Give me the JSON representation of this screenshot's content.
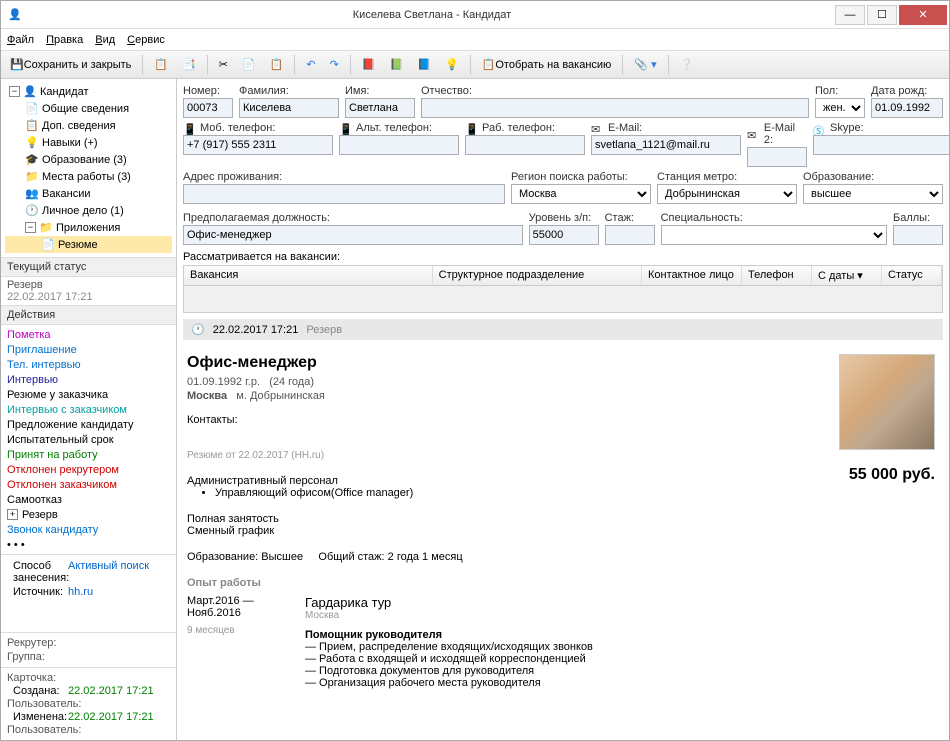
{
  "window": {
    "title": "Киселева Светлана - Кандидат"
  },
  "menu": {
    "file": "Файл",
    "edit": "Правка",
    "view": "Вид",
    "service": "Сервис"
  },
  "toolbar": {
    "save_close": "Сохранить и закрыть",
    "select_vacancy": "Отобрать на вакансию"
  },
  "tree": {
    "root": "Кандидат",
    "general": "Общие сведения",
    "additional": "Доп. сведения",
    "skills": "Навыки (+)",
    "education": "Образование (3)",
    "workplaces": "Места работы (3)",
    "vacancies": "Вакансии",
    "personal": "Личное дело  (1)",
    "attachments": "Приложения",
    "resume": "Резюме"
  },
  "status": {
    "title": "Текущий статус",
    "value": "Резерв",
    "date": "22.02.2017 17:21"
  },
  "actions": {
    "title": "Действия",
    "items": [
      {
        "label": "Пометка",
        "cls": "magenta"
      },
      {
        "label": "Приглашение",
        "cls": "blue"
      },
      {
        "label": "Тел. интервью",
        "cls": "blue"
      },
      {
        "label": "Интервью",
        "cls": "navy"
      },
      {
        "label": "Резюме у заказчика",
        "cls": ""
      },
      {
        "label": "Интервью с заказчиком",
        "cls": "cyan"
      },
      {
        "label": "Предложение кандидату",
        "cls": ""
      },
      {
        "label": "Испытательный срок",
        "cls": ""
      },
      {
        "label": "Принят на работу",
        "cls": "green"
      },
      {
        "label": "Отклонен рекрутером",
        "cls": "red"
      },
      {
        "label": "Отклонен заказчиком",
        "cls": "red"
      },
      {
        "label": "Самоотказ",
        "cls": ""
      },
      {
        "label": "Резерв",
        "cls": ""
      },
      {
        "label": "Звонок кандидату",
        "cls": "blue"
      },
      {
        "label": "• • •",
        "cls": ""
      }
    ]
  },
  "meta": {
    "method_label": "Способ занесения:",
    "method_value": "Активный поиск",
    "source_label": "Источник:",
    "source_value": "hh.ru",
    "recruiter_label": "Рекрутер:",
    "group_label": "Группа:",
    "card_label": "Карточка:",
    "created_label": "Создана:",
    "created_value": "22.02.2017 17:21",
    "user1_label": "Пользователь:",
    "changed_label": "Изменена:",
    "changed_value": "22.02.2017 17:21",
    "user2_label": "Пользователь:"
  },
  "form": {
    "number_label": "Номер:",
    "number": "00073",
    "lastname_label": "Фамилия:",
    "lastname": "Киселева",
    "firstname_label": "Имя:",
    "firstname": "Светлана",
    "middlename_label": "Отчество:",
    "middlename": "",
    "sex_label": "Пол:",
    "sex": "жен.",
    "dob_label": "Дата рожд:",
    "dob": "01.09.1992",
    "mobile_label": "Моб. телефон:",
    "mobile": "+7 (917) 555 2311",
    "alt_label": "Альт. телефон:",
    "alt": "",
    "work_label": "Раб. телефон:",
    "work": "",
    "email_label": "E-Mail:",
    "email": "svetlana_1121@mail.ru",
    "email2_label": "E-Mail 2:",
    "email2": "",
    "skype_label": "Skype:",
    "skype": "",
    "address_label": "Адрес проживания:",
    "address": "",
    "region_label": "Регион поиска работы:",
    "region": "Москва",
    "metro_label": "Станция метро:",
    "metro": "Добрынинская",
    "edu_label": "Образование:",
    "edu": "высшее",
    "position_label": "Предполагаемая должность:",
    "position": "Офис-менеджер",
    "salary_label": "Уровень з/п:",
    "salary": "55000",
    "experience_label": "Стаж:",
    "experience": "",
    "speciality_label": "Специальность:",
    "speciality": "",
    "points_label": "Баллы:",
    "points": "",
    "vacancies_label": "Рассматривается на вакансии:"
  },
  "grid": {
    "col1": "Вакансия",
    "col2": "Структурное подразделение",
    "col3": "Контактное лицо",
    "col4": "Телефон",
    "col5": "С даты",
    "col6": "Статус"
  },
  "statusbar": {
    "date": "22.02.2017  17:21",
    "status": "Резерв"
  },
  "resume": {
    "title": "Офис-менеджер",
    "dob": "01.09.1992 г.р.",
    "age": "(24 года)",
    "city": "Москва",
    "metro": "м. Добрынинская",
    "contacts": "Контакты:",
    "source": "Резюме от 22.02.2017   (HH.ru)",
    "category": "Административный персонал",
    "subcat": "Управляющий офисом(Office manager)",
    "salary": "55 000 руб.",
    "employment": "Полная занятость",
    "schedule": "Сменный график",
    "edu": "Образование: Высшее",
    "exp_total": "Общий стаж: 2 года 1 месяц",
    "exp_header": "Опыт работы",
    "job1_period": "Март.2016 — Нояб.2016",
    "job1_dur": "9 месяцев",
    "job1_company": "Гардарика тур",
    "job1_city": "Москва",
    "job1_position": "Помощник руководителя",
    "job1_d1": "— Прием, распределение входящих/исходящих звонков",
    "job1_d2": "— Работа с входящей и исходящей корреспонденцией",
    "job1_d3": "— Подготовка документов для руководителя",
    "job1_d4": "— Организация рабочего места руководителя"
  }
}
